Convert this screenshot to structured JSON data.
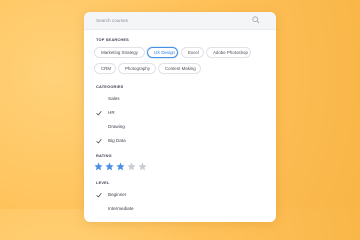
{
  "search": {
    "placeholder": "Search courses",
    "icon": "search-icon"
  },
  "top_searches": {
    "title": "TOP SEARCHES",
    "chips": [
      {
        "label": "Marketing Strategy",
        "selected": false
      },
      {
        "label": "UX Design",
        "selected": true
      },
      {
        "label": "Excel",
        "selected": false
      },
      {
        "label": "Adobe Photoshop",
        "selected": false
      },
      {
        "label": "CRM",
        "selected": false
      },
      {
        "label": "Photography",
        "selected": false
      },
      {
        "label": "Content Making",
        "selected": false
      }
    ]
  },
  "categories": {
    "title": "CATEGORIES",
    "items": [
      {
        "label": "Sales",
        "checked": false
      },
      {
        "label": "HR",
        "checked": true
      },
      {
        "label": "Drawing",
        "checked": false
      },
      {
        "label": "Big Data",
        "checked": true
      }
    ]
  },
  "rating": {
    "title": "RATING",
    "value": 3,
    "max": 5
  },
  "level": {
    "title": "LEVEL",
    "items": [
      {
        "label": "Beginner",
        "checked": true
      },
      {
        "label": "Intermediate",
        "checked": false
      }
    ]
  },
  "colors": {
    "accent": "#4a90e2",
    "star_filled": "#4a90e2",
    "star_empty": "#c9ccd1",
    "background": "#ffc25a"
  }
}
